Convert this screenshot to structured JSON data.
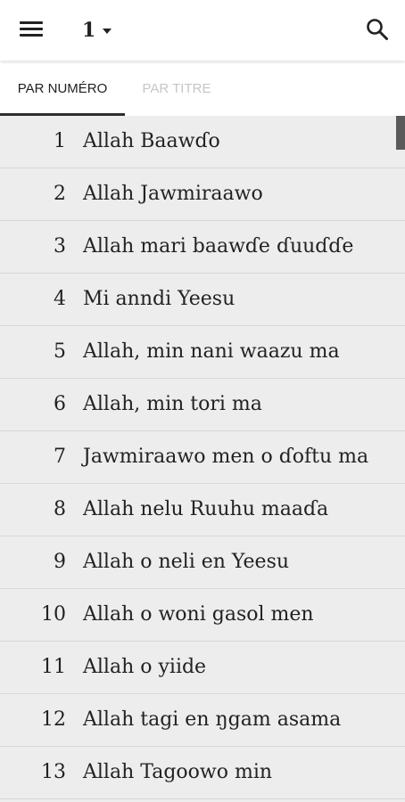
{
  "header": {
    "book_number": "1",
    "icons": {
      "menu": "menu-icon",
      "dropdown": "caret-down-icon",
      "search": "search-icon"
    }
  },
  "tabs": [
    {
      "label": "PAR NUMÉRO",
      "active": true
    },
    {
      "label": "PAR TITRE",
      "active": false
    }
  ],
  "songs": [
    {
      "number": "1",
      "title": "Allah Baawɗo"
    },
    {
      "number": "2",
      "title": "Allah Jawmiraawo"
    },
    {
      "number": "3",
      "title": "Allah mari baawɗe ɗuuɗɗe"
    },
    {
      "number": "4",
      "title": "Mi anndi Yeesu"
    },
    {
      "number": "5",
      "title": "Allah, min nani waazu ma"
    },
    {
      "number": "6",
      "title": "Allah, min tori ma"
    },
    {
      "number": "7",
      "title": "Jawmiraawo men o ɗoftu ma"
    },
    {
      "number": "8",
      "title": "Allah nelu Ruuhu maaɗa"
    },
    {
      "number": "9",
      "title": "Allah o neli en Yeesu"
    },
    {
      "number": "10",
      "title": "Allah o woni gasol men"
    },
    {
      "number": "11",
      "title": "Allah o yiide"
    },
    {
      "number": "12",
      "title": "Allah tagi en ŋgam asama"
    },
    {
      "number": "13",
      "title": "Allah Tagoowo min"
    }
  ],
  "colors": {
    "appbar": "#ffffff",
    "list_background": "#ededed",
    "divider": "#d7d7d7",
    "text": "#222222",
    "inactive_tab": "#c6c6c6",
    "tab_indicator": "#2e2e2e",
    "scroll_thumb": "#5a5a5a"
  }
}
